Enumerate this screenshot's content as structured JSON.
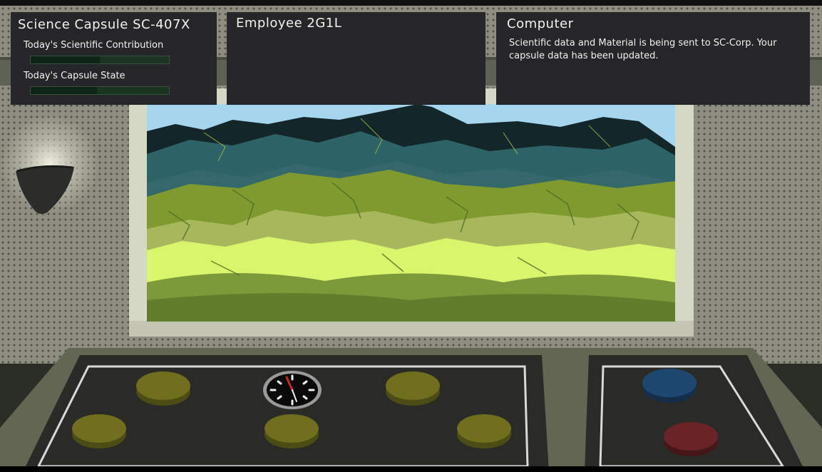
{
  "capsule_panel": {
    "title": "Science Capsule SC-407X",
    "contribution_label": "Today's Scientific Contribution",
    "contribution_level": 0.5,
    "state_label": "Today's Capsule State",
    "state_level": 0.48
  },
  "employee_panel": {
    "title": "Employee 2G1L"
  },
  "computer_panel": {
    "title": "Computer",
    "message": "Scientific data and Material is being sent to SC-Corp. Your capsule data has been updated."
  },
  "colors": {
    "panel_bg": "#262628",
    "button_yellow": "#6f6f1d",
    "button_blue": "#1f4870",
    "button_red": "#6a2326",
    "grass_light": "#d9f56b",
    "mountain_dark": "#13262a",
    "mountain_teal": "#2d6266"
  },
  "icons": {
    "lamp": "wall-lamp-icon",
    "clock": "gauge-clock-icon"
  }
}
